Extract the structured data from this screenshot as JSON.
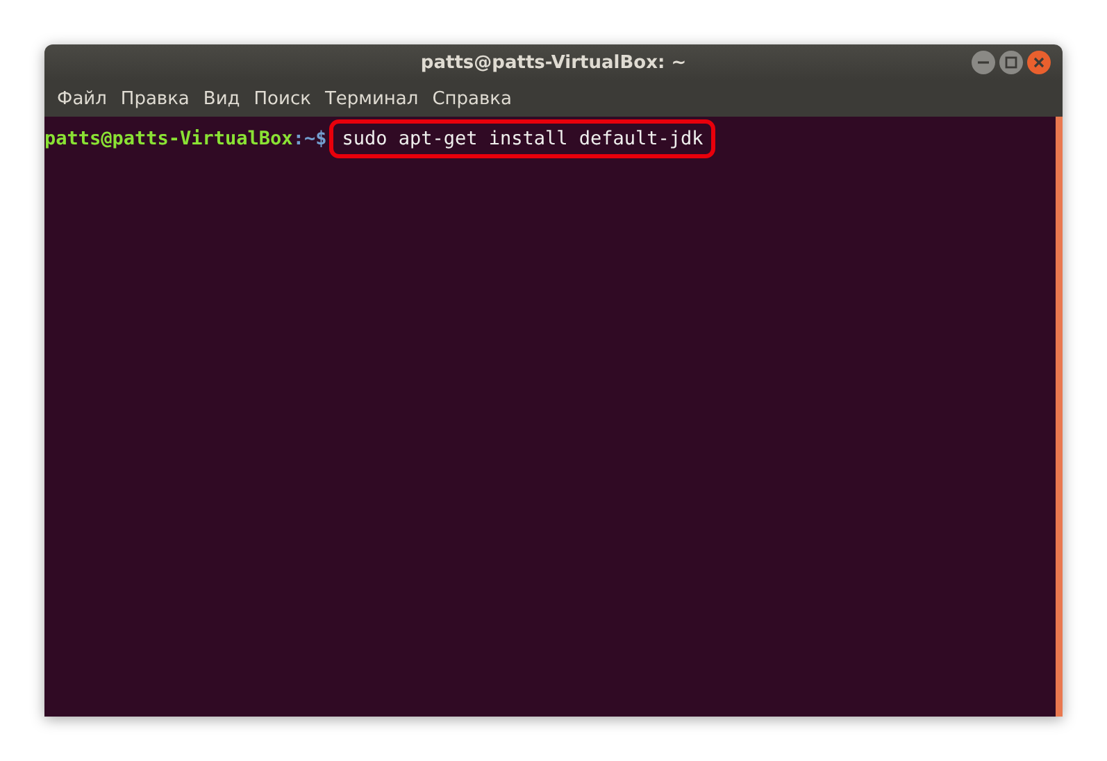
{
  "window": {
    "title": "patts@patts-VirtualBox: ~"
  },
  "menu": [
    "Файл",
    "Правка",
    "Вид",
    "Поиск",
    "Терминал",
    "Справка"
  ],
  "terminal": {
    "prompt_user": "patts@patts-VirtualBox",
    "prompt_path": ":~$",
    "command": "sudo apt-get install default-jdk",
    "highlighted": true
  }
}
